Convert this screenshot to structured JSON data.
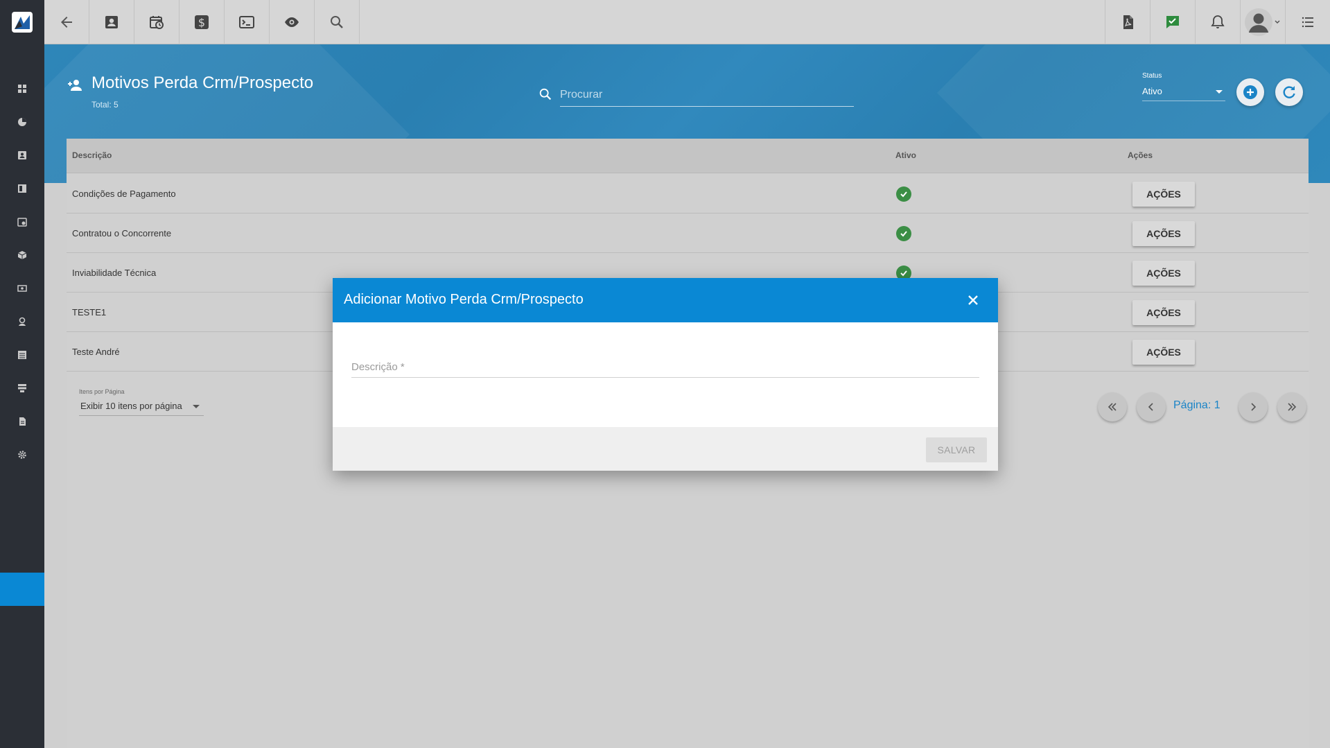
{
  "app": {
    "toolbar": {
      "left_icons": [
        "back-arrow-icon",
        "contact-card-icon",
        "calendar-clock-icon",
        "dollar-icon",
        "terminal-icon",
        "eye-icon",
        "search-icon"
      ],
      "right_icons": [
        "pdf-icon",
        "chat-check-icon",
        "bell-icon",
        "avatar",
        "menu-list-icon"
      ]
    },
    "sidebar": {
      "items": [
        "dashboard-icon",
        "pie-chart-icon",
        "contact-icon",
        "book-icon",
        "calendar-icon",
        "box-icon",
        "money-icon",
        "location-icon",
        "list-icon",
        "server-icon",
        "file-icon",
        "gear-icon"
      ]
    }
  },
  "header": {
    "title": "Motivos Perda Crm/Prospecto",
    "total": "Total: 5",
    "search_placeholder": "Procurar",
    "status_label": "Status",
    "status_value": "Ativo"
  },
  "table": {
    "columns": [
      "Descrição",
      "Ativo",
      "Ações"
    ],
    "action_label": "AÇÕES",
    "rows": [
      {
        "descricao": "Condições de Pagamento",
        "ativo": true
      },
      {
        "descricao": "Contratou o Concorrente",
        "ativo": true
      },
      {
        "descricao": "Inviabilidade Técnica",
        "ativo": true
      },
      {
        "descricao": "TESTE1",
        "ativo": true
      },
      {
        "descricao": "Teste André",
        "ativo": true
      }
    ]
  },
  "pagination": {
    "items_label": "Itens por Página",
    "items_value": "Exibir 10 itens por página",
    "page_label": "Página: 1"
  },
  "modal": {
    "title": "Adicionar Motivo Perda Crm/Prospecto",
    "field_placeholder": "Descrição *",
    "field_value": "",
    "save_label": "SALVAR"
  },
  "colors": {
    "accent": "#0a88d4",
    "header_blue": "#2e86b9",
    "sidebar": "#2b2f36",
    "check_green": "#3b8e45"
  }
}
